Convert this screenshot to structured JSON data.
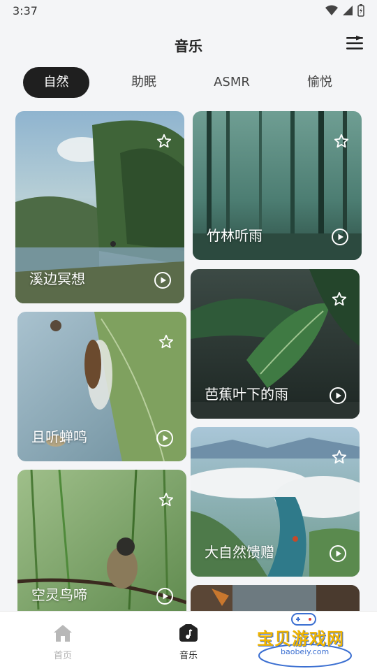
{
  "status_bar": {
    "time": "3:37"
  },
  "header": {
    "title": "音乐"
  },
  "tabs": [
    {
      "label": "自然",
      "active": true
    },
    {
      "label": "助眠",
      "active": false
    },
    {
      "label": "ASMR",
      "active": false
    },
    {
      "label": "愉悦",
      "active": false
    }
  ],
  "cards": {
    "c1": {
      "title": "溪边冥想"
    },
    "c2": {
      "title": "竹林听雨"
    },
    "c3": {
      "title": "且听蝉鸣"
    },
    "c4": {
      "title": "芭蕉叶下的雨"
    },
    "c5": {
      "title": "空灵鸟啼"
    },
    "c6": {
      "title": "大自然馈赠"
    },
    "c7": {
      "title": ""
    }
  },
  "bottom_nav": {
    "home": {
      "label": "首页"
    },
    "music": {
      "label": "音乐"
    }
  },
  "watermark": {
    "text": "宝贝游戏网",
    "sub": "baobeiy.com"
  },
  "colors": {
    "tab_active_bg": "#1f1f1f",
    "background": "#f4f5f7"
  }
}
